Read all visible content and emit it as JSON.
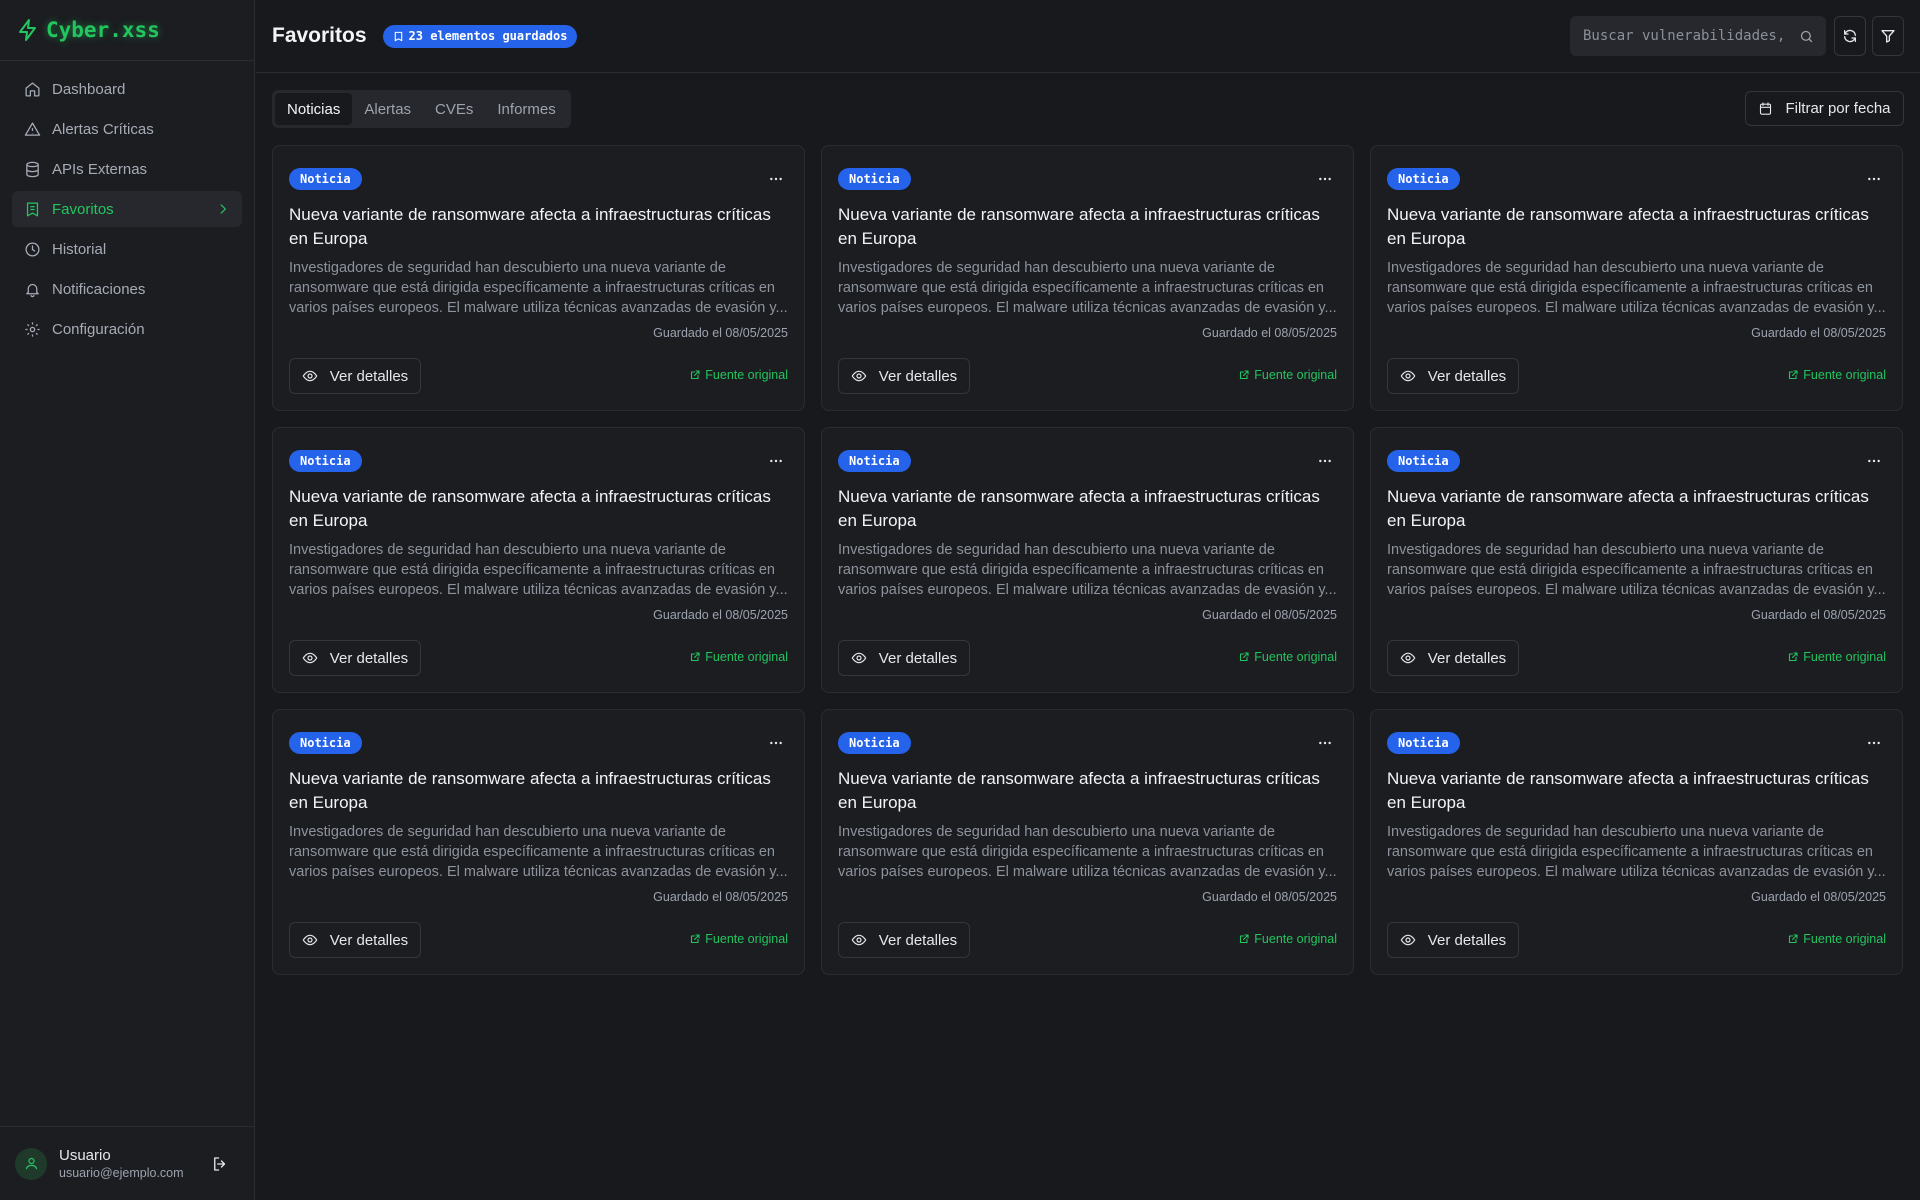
{
  "brand": {
    "name": "Cyber.xss",
    "accent": "#22c55e"
  },
  "sidebar": {
    "items": [
      {
        "label": "Dashboard",
        "icon": "home-icon",
        "active": false
      },
      {
        "label": "Alertas Críticas",
        "icon": "alert-triangle-icon",
        "active": false
      },
      {
        "label": "APIs Externas",
        "icon": "database-icon",
        "active": false
      },
      {
        "label": "Favoritos",
        "icon": "bookmark-icon",
        "active": true
      },
      {
        "label": "Historial",
        "icon": "clock-icon",
        "active": false
      },
      {
        "label": "Notificaciones",
        "icon": "bell-icon",
        "active": false
      },
      {
        "label": "Configuración",
        "icon": "gear-icon",
        "active": false
      }
    ]
  },
  "user": {
    "name": "Usuario",
    "email": "usuario@ejemplo.com"
  },
  "header": {
    "title": "Favoritos",
    "count_label": "23 elementos guardados",
    "search_placeholder": "Buscar vulnerabilidades, amenazas..."
  },
  "tabs": [
    {
      "label": "Noticias",
      "active": true
    },
    {
      "label": "Alertas",
      "active": false
    },
    {
      "label": "CVEs",
      "active": false
    },
    {
      "label": "Informes",
      "active": false
    }
  ],
  "date_filter_label": "Filtrar por fecha",
  "cards": [
    {
      "badge": "Noticia",
      "title": "Nueva variante de ransomware afecta a infraestructuras críticas en Europa",
      "description": "Investigadores de seguridad han descubierto una nueva variante de ransomware que está dirigida específicamente a infraestructuras críticas en varios países europeos. El malware utiliza técnicas avanzadas de evasión y...",
      "saved": "Guardado el 08/05/2025",
      "details_label": "Ver detalles",
      "source_label": "Fuente original"
    },
    {
      "badge": "Noticia",
      "title": "Nueva variante de ransomware afecta a infraestructuras críticas en Europa",
      "description": "Investigadores de seguridad han descubierto una nueva variante de ransomware que está dirigida específicamente a infraestructuras críticas en varios países europeos. El malware utiliza técnicas avanzadas de evasión y...",
      "saved": "Guardado el 08/05/2025",
      "details_label": "Ver detalles",
      "source_label": "Fuente original"
    },
    {
      "badge": "Noticia",
      "title": "Nueva variante de ransomware afecta a infraestructuras críticas en Europa",
      "description": "Investigadores de seguridad han descubierto una nueva variante de ransomware que está dirigida específicamente a infraestructuras críticas en varios países europeos. El malware utiliza técnicas avanzadas de evasión y...",
      "saved": "Guardado el 08/05/2025",
      "details_label": "Ver detalles",
      "source_label": "Fuente original"
    },
    {
      "badge": "Noticia",
      "title": "Nueva variante de ransomware afecta a infraestructuras críticas en Europa",
      "description": "Investigadores de seguridad han descubierto una nueva variante de ransomware que está dirigida específicamente a infraestructuras críticas en varios países europeos. El malware utiliza técnicas avanzadas de evasión y...",
      "saved": "Guardado el 08/05/2025",
      "details_label": "Ver detalles",
      "source_label": "Fuente original"
    },
    {
      "badge": "Noticia",
      "title": "Nueva variante de ransomware afecta a infraestructuras críticas en Europa",
      "description": "Investigadores de seguridad han descubierto una nueva variante de ransomware que está dirigida específicamente a infraestructuras críticas en varios países europeos. El malware utiliza técnicas avanzadas de evasión y...",
      "saved": "Guardado el 08/05/2025",
      "details_label": "Ver detalles",
      "source_label": "Fuente original"
    },
    {
      "badge": "Noticia",
      "title": "Nueva variante de ransomware afecta a infraestructuras críticas en Europa",
      "description": "Investigadores de seguridad han descubierto una nueva variante de ransomware que está dirigida específicamente a infraestructuras críticas en varios países europeos. El malware utiliza técnicas avanzadas de evasión y...",
      "saved": "Guardado el 08/05/2025",
      "details_label": "Ver detalles",
      "source_label": "Fuente original"
    },
    {
      "badge": "Noticia",
      "title": "Nueva variante de ransomware afecta a infraestructuras críticas en Europa",
      "description": "Investigadores de seguridad han descubierto una nueva variante de ransomware que está dirigida específicamente a infraestructuras críticas en varios países europeos. El malware utiliza técnicas avanzadas de evasión y...",
      "saved": "Guardado el 08/05/2025",
      "details_label": "Ver detalles",
      "source_label": "Fuente original"
    },
    {
      "badge": "Noticia",
      "title": "Nueva variante de ransomware afecta a infraestructuras críticas en Europa",
      "description": "Investigadores de seguridad han descubierto una nueva variante de ransomware que está dirigida específicamente a infraestructuras críticas en varios países europeos. El malware utiliza técnicas avanzadas de evasión y...",
      "saved": "Guardado el 08/05/2025",
      "details_label": "Ver detalles",
      "source_label": "Fuente original"
    },
    {
      "badge": "Noticia",
      "title": "Nueva variante de ransomware afecta a infraestructuras críticas en Europa",
      "description": "Investigadores de seguridad han descubierto una nueva variante de ransomware que está dirigida específicamente a infraestructuras críticas en varios países europeos. El malware utiliza técnicas avanzadas de evasión y...",
      "saved": "Guardado el 08/05/2025",
      "details_label": "Ver detalles",
      "source_label": "Fuente original"
    }
  ]
}
